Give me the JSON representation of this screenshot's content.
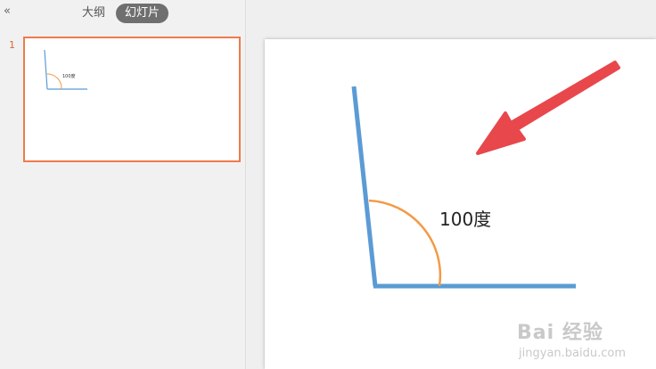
{
  "sidebar": {
    "collapse_glyph": "«",
    "tabs": [
      {
        "label": "大纲",
        "active": false
      },
      {
        "label": "幻灯片",
        "active": true
      }
    ],
    "slides": [
      {
        "number": "1",
        "thumbnail_label": "100度"
      }
    ]
  },
  "slide": {
    "angle_label": "100度",
    "colors": {
      "lines": "#5b9bd5",
      "arc": "#f39a46",
      "arrow": "#e8474c"
    }
  },
  "watermark": {
    "line1": "Bai 经验",
    "line2": "jingyan.baidu.com"
  }
}
